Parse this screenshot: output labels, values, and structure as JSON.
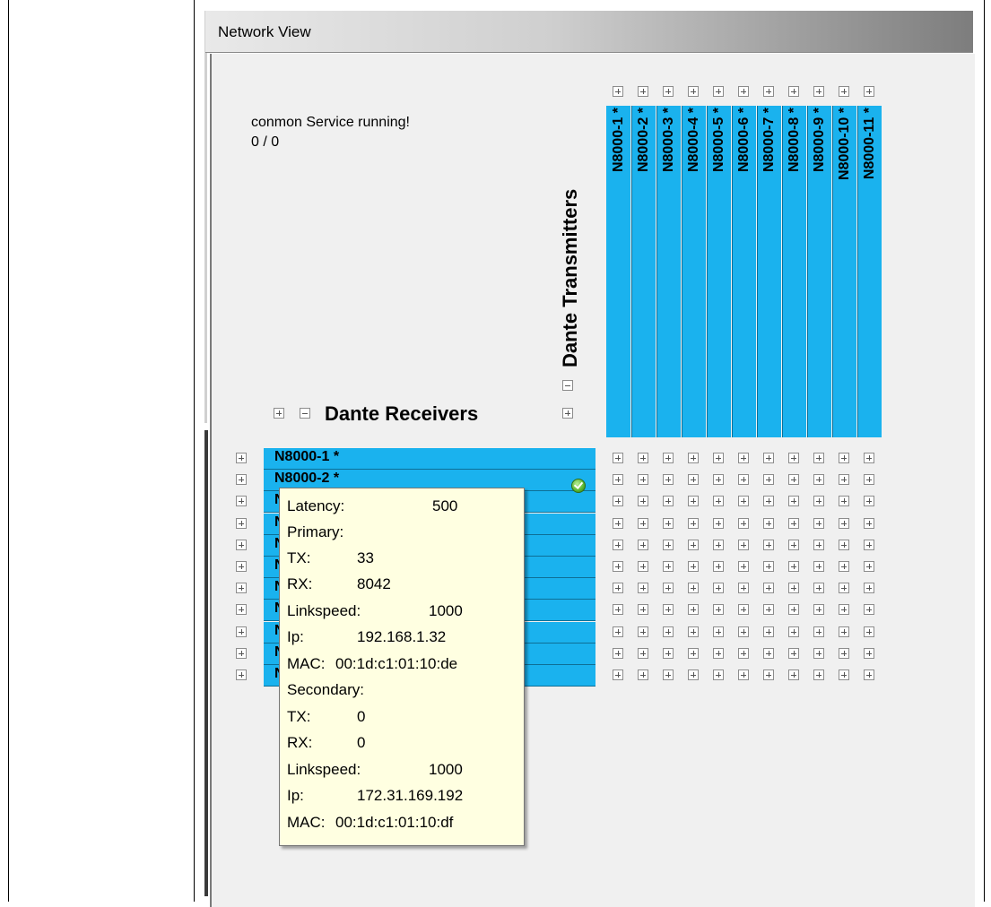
{
  "window": {
    "title": "Network View"
  },
  "status": {
    "service": "conmon Service running!",
    "count": "0 / 0"
  },
  "headers": {
    "transmitters": "Dante Transmitters",
    "receivers": "Dante Receivers"
  },
  "transmitters": [
    "N8000-1 *",
    "N8000-2 *",
    "N8000-3 *",
    "N8000-4 *",
    "N8000-5 *",
    "N8000-6 *",
    "N8000-7 *",
    "N8000-8 *",
    "N8000-9 *",
    "N8000-10 *",
    "N8000-11 *"
  ],
  "receivers": [
    "N8000-1 *",
    "N8000-2 *",
    "N",
    "N",
    "N",
    "N",
    "N",
    "N",
    "N",
    "N",
    "N"
  ],
  "tooltip": {
    "latency_label": "Latency:",
    "latency_value": "500",
    "primary_label": "Primary:",
    "p_tx_label": "TX:",
    "p_tx_value": "33",
    "p_rx_label": "RX:",
    "p_rx_value": "8042",
    "p_link_label": "Linkspeed:",
    "p_link_value": "1000",
    "p_ip_label": "Ip:",
    "p_ip_value": "192.168.1.32",
    "p_mac_label": "MAC:",
    "p_mac_value": "00:1d:c1:01:10:de",
    "secondary_label": "Secondary:",
    "s_tx_label": "TX:",
    "s_tx_value": "0",
    "s_rx_label": "RX:",
    "s_rx_value": "0",
    "s_link_label": "Linkspeed:",
    "s_link_value": "1000",
    "s_ip_label": "Ip:",
    "s_ip_value": "172.31.169.192",
    "s_mac_label": "MAC:",
    "s_mac_value": "00:1d:c1:01:10:df"
  },
  "colors": {
    "device_fill": "#1ab2ee",
    "tooltip_bg": "#ffffe1",
    "client_bg": "#f0f0f0"
  },
  "icons": {
    "status_ok": "green-check-icon",
    "expand": "plus-box-icon",
    "collapse": "minus-box-icon"
  }
}
